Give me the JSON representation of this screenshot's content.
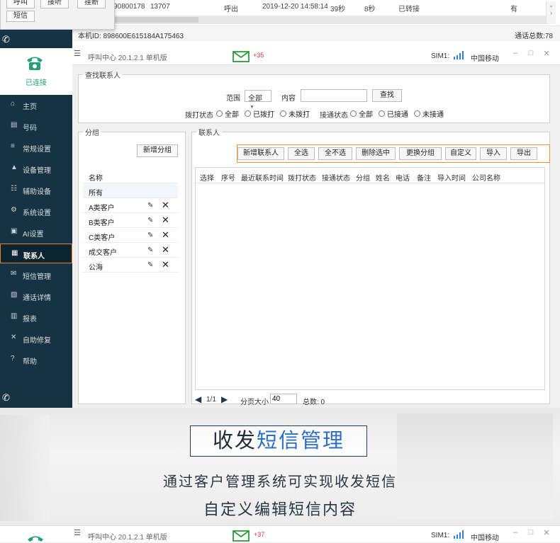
{
  "top_strip": {
    "popup_buttons": [
      "呼叫",
      "接听",
      "挂断",
      "短信"
    ],
    "row": {
      "number": "90800178",
      "callee": "13707",
      "direction": "呼出",
      "datetime": "2019-12-20 14:58:14",
      "duration": "39秒",
      "ring": "8秒",
      "result": "已转接",
      "recording": "有"
    },
    "device_id": "本机ID:  898600E615184A175463",
    "total_calls": "通话总数:78"
  },
  "app": {
    "brand_status": "已连接",
    "title": "呼叫中心  20.1.2.1  单机版",
    "sms_count": "+35",
    "sim_label": "SIM1:",
    "carrier": "中国移动",
    "colors": {
      "sidebar": "#153343",
      "accent": "#e6852a",
      "connected": "#23a074"
    },
    "nav": [
      {
        "icon": "home-icon",
        "glyph": "⌂",
        "label": "主页"
      },
      {
        "icon": "number-icon",
        "glyph": "▤",
        "label": "号码"
      },
      {
        "icon": "settings-icon",
        "glyph": "≡",
        "label": "常规设置"
      },
      {
        "icon": "device-icon",
        "glyph": "▲",
        "label": "设备管理"
      },
      {
        "icon": "aux-device-icon",
        "glyph": "☷",
        "label": "辅助设备"
      },
      {
        "icon": "system-settings-icon",
        "glyph": "⚙",
        "label": "系统设置"
      },
      {
        "icon": "ai-icon",
        "glyph": "▣",
        "label": "AI设置"
      },
      {
        "icon": "contacts-icon",
        "glyph": "▦",
        "label": "联系人"
      },
      {
        "icon": "sms-icon",
        "glyph": "✉",
        "label": "短信管理"
      },
      {
        "icon": "call-detail-icon",
        "glyph": "▧",
        "label": "通话详情"
      },
      {
        "icon": "report-icon",
        "glyph": "▥",
        "label": "报表"
      },
      {
        "icon": "repair-icon",
        "glyph": "✕",
        "label": "自助修复"
      },
      {
        "icon": "help-icon",
        "glyph": "?",
        "label": "帮助"
      }
    ],
    "active_nav": "联系人",
    "search": {
      "legend": "查找联系人",
      "range_label": "范围",
      "range_value": "全部",
      "content_label": "内容",
      "content_value": "",
      "search_button": "查找",
      "dial_status_label": "拨打状态",
      "dial_options": [
        "全部",
        "已拨打",
        "未拨打"
      ],
      "connect_status_label": "接通状态",
      "connect_options": [
        "全部",
        "已接通",
        "未接通"
      ]
    },
    "groups": {
      "legend": "分组",
      "add_button": "新增分组",
      "header": "名称",
      "all": "所有",
      "items": [
        "A类客户",
        "B类客户",
        "C类客户",
        "成交客户",
        "公海"
      ]
    },
    "contacts": {
      "legend": "联系人",
      "toolbar": [
        "新增联系人",
        "全选",
        "全不选",
        "删除选中",
        "更换分组",
        "自定义",
        "导入",
        "导出"
      ],
      "columns": [
        "选择",
        "序号",
        "最近联系时间",
        "拨打状态",
        "接通状态",
        "分组",
        "姓名",
        "电话",
        "备注",
        "导入时间",
        "公司名称"
      ],
      "pager": {
        "page": "1/1",
        "page_size_label": "分页大小",
        "page_size": "40",
        "total": "总数:  0"
      }
    }
  },
  "banner": {
    "headline_a": "收发",
    "headline_b": "短信管理",
    "line1": "通过客户管理系统可实现收发短信",
    "line2": "自定义编辑短信内容"
  },
  "app2": {
    "title": "呼叫中心  20.1.2.1  单机版",
    "sms_count": "+37",
    "sim_label": "SIM1:",
    "carrier": "中国移动"
  }
}
